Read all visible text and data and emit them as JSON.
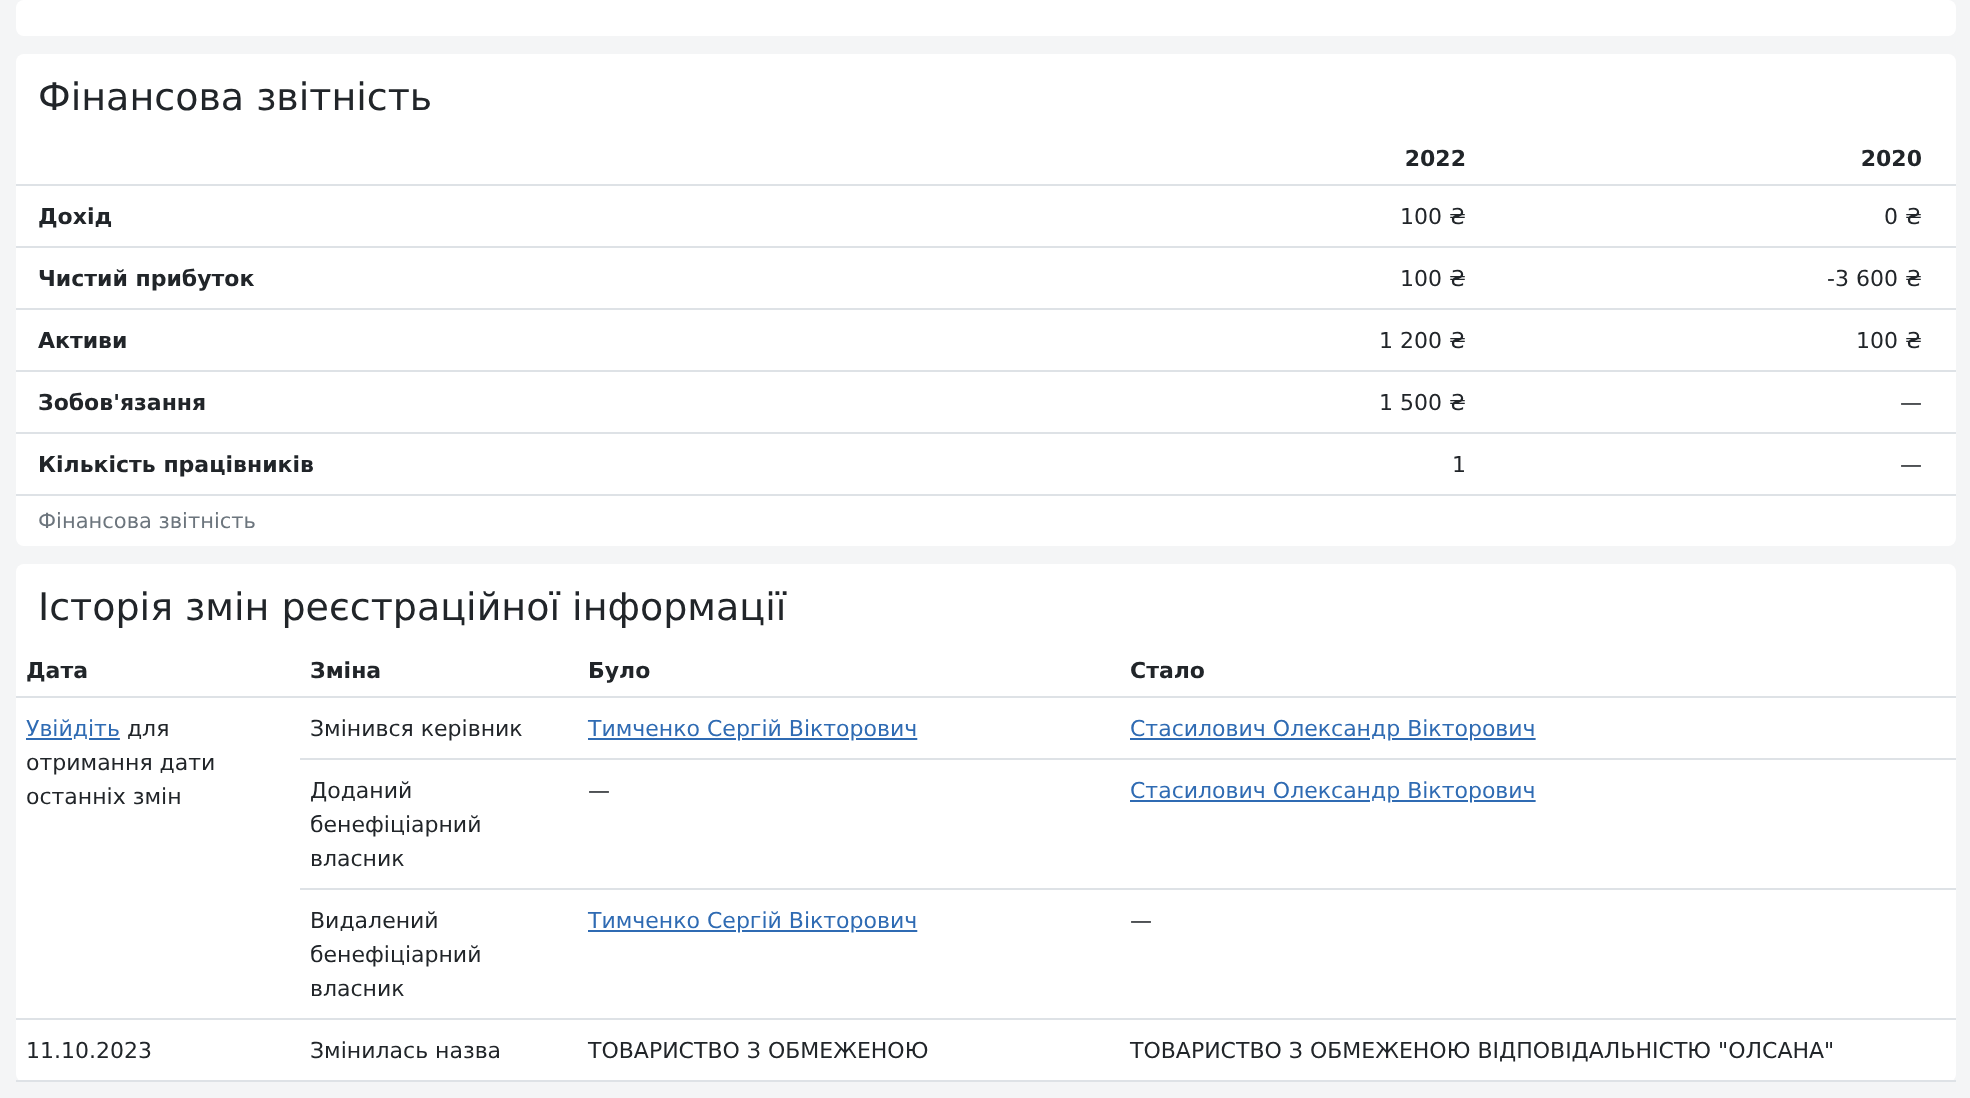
{
  "financial": {
    "title": "Фінансова звітність",
    "years": [
      "2022",
      "2020"
    ],
    "rows": [
      {
        "label": "Дохід",
        "values": [
          "100 ₴",
          "0 ₴"
        ]
      },
      {
        "label": "Чистий прибуток",
        "values": [
          "100 ₴",
          "-3 600 ₴"
        ]
      },
      {
        "label": "Активи",
        "values": [
          "1 200 ₴",
          "100 ₴"
        ]
      },
      {
        "label": "Зобов'язання",
        "values": [
          "1 500 ₴",
          "—"
        ]
      },
      {
        "label": "Кількість працівників",
        "values": [
          "1",
          "—"
        ]
      }
    ],
    "footnote": "Фінансова звітність"
  },
  "history": {
    "title": "Історія змін реєстраційної інформації",
    "columns": [
      "Дата",
      "Зміна",
      "Було",
      "Стало"
    ],
    "groups": [
      {
        "date": {
          "link": "Увійдіть",
          "text": " для отримання дати останніх змін"
        },
        "changes": [
          {
            "change": "Змінився керівник",
            "was": {
              "text": "Тимченко Сергій Вікторович",
              "link": true
            },
            "became": {
              "text": "Стасилович Олександр Вікторович",
              "link": true
            }
          },
          {
            "change": "Доданий бенефіціарний власник",
            "was": {
              "text": "—",
              "link": false
            },
            "became": {
              "text": "Стасилович Олександр Вікторович",
              "link": true
            }
          },
          {
            "change": "Видалений бенефіціарний власник",
            "was": {
              "text": "Тимченко Сергій Вікторович",
              "link": true
            },
            "became": {
              "text": "—",
              "link": false
            }
          }
        ]
      },
      {
        "date": {
          "text": "11.10.2023"
        },
        "changes": [
          {
            "change": "Змінилась назва",
            "was": {
              "text": "ТОВАРИСТВО З ОБМЕЖЕНОЮ",
              "link": false
            },
            "became": {
              "text": "ТОВАРИСТВО З ОБМЕЖЕНОЮ ВІДПОВІДАЛЬНІСТЮ \"ОЛСАНА\"",
              "link": false
            }
          }
        ]
      }
    ]
  }
}
